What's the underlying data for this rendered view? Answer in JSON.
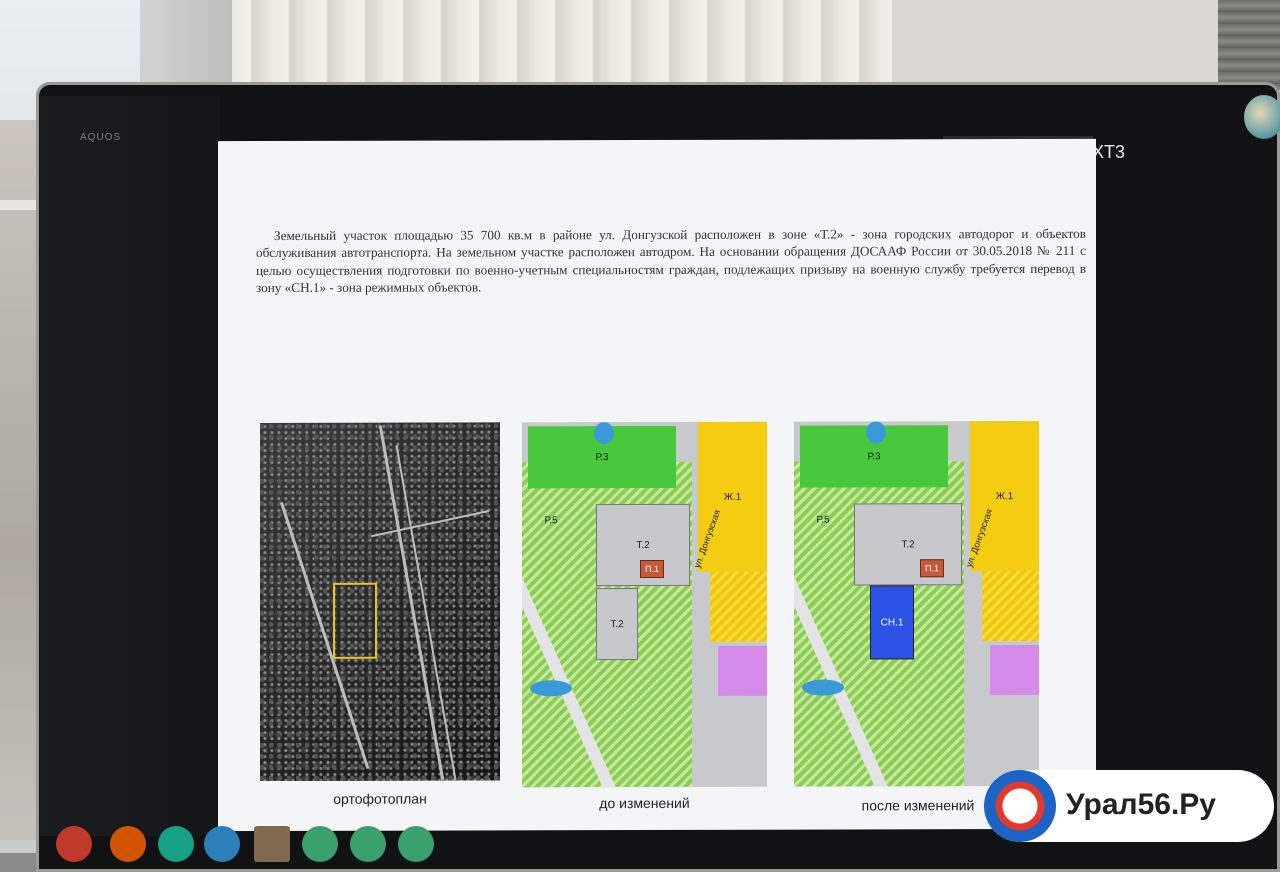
{
  "monitor": {
    "brand": "AQUOS",
    "ext_label": "EXT3",
    "slide_badge_number": "3"
  },
  "slide": {
    "paragraph": "Земельный участок площадью 35 700 кв.м в районе ул. Донгузской расположен в зоне «Т.2» - зона городских автодорог и объектов обслуживания автотранспорта. На земельном участке расположен автодром. На основании обращения ДОСААФ России от 30.05.2018 № 211 с целью осуществления подготовки по военно-учетным специальностям граждан, подлежащих призыву на военную службу требуется перевод  в зону «СН.1» - зона режимных объектов.",
    "panels": [
      {
        "caption": "ортофотоплан"
      },
      {
        "caption": "до изменений"
      },
      {
        "caption": "после изменений"
      }
    ],
    "map_labels": {
      "p3": "Р.3",
      "p5": "Р.5",
      "zh1": "Ж.1",
      "t2": "Т.2",
      "p1": "П.1",
      "cn1": "СН.1",
      "street": "ул. Донгузская"
    },
    "ortho_street": "ул. Донгузская"
  },
  "logo": {
    "text": "Урал56.Ру"
  },
  "colors": {
    "green_zone": "#48c83d",
    "yellow_zone": "#f4cd12",
    "cn_zone": "#2d52e6",
    "p_zone": "#c7593a",
    "violet_zone": "#d58be8",
    "selection": "#e5c323"
  }
}
